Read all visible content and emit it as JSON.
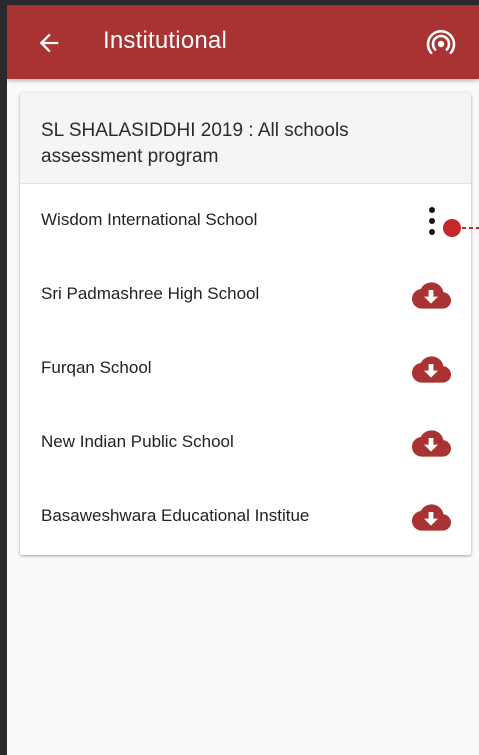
{
  "appbar": {
    "title": "Institutional",
    "back_icon": "arrow-back-icon",
    "sync_icon": "wifi-sync-icon",
    "color": "#a93232"
  },
  "program": {
    "title": "SL SHALASIDDHI 2019 : All schools assessment program"
  },
  "schools": [
    {
      "name": "Wisdom International School",
      "action": "more-options-icon"
    },
    {
      "name": "Sri Padmashree High School",
      "action": "cloud-download-icon"
    },
    {
      "name": "Furqan School",
      "action": "cloud-download-icon"
    },
    {
      "name": "New Indian Public School",
      "action": "cloud-download-icon"
    },
    {
      "name": "Basaweshwara Educational Institue",
      "action": "cloud-download-icon"
    }
  ],
  "colors": {
    "accent": "#a93232",
    "tutorial_pointer": "#c62828"
  }
}
